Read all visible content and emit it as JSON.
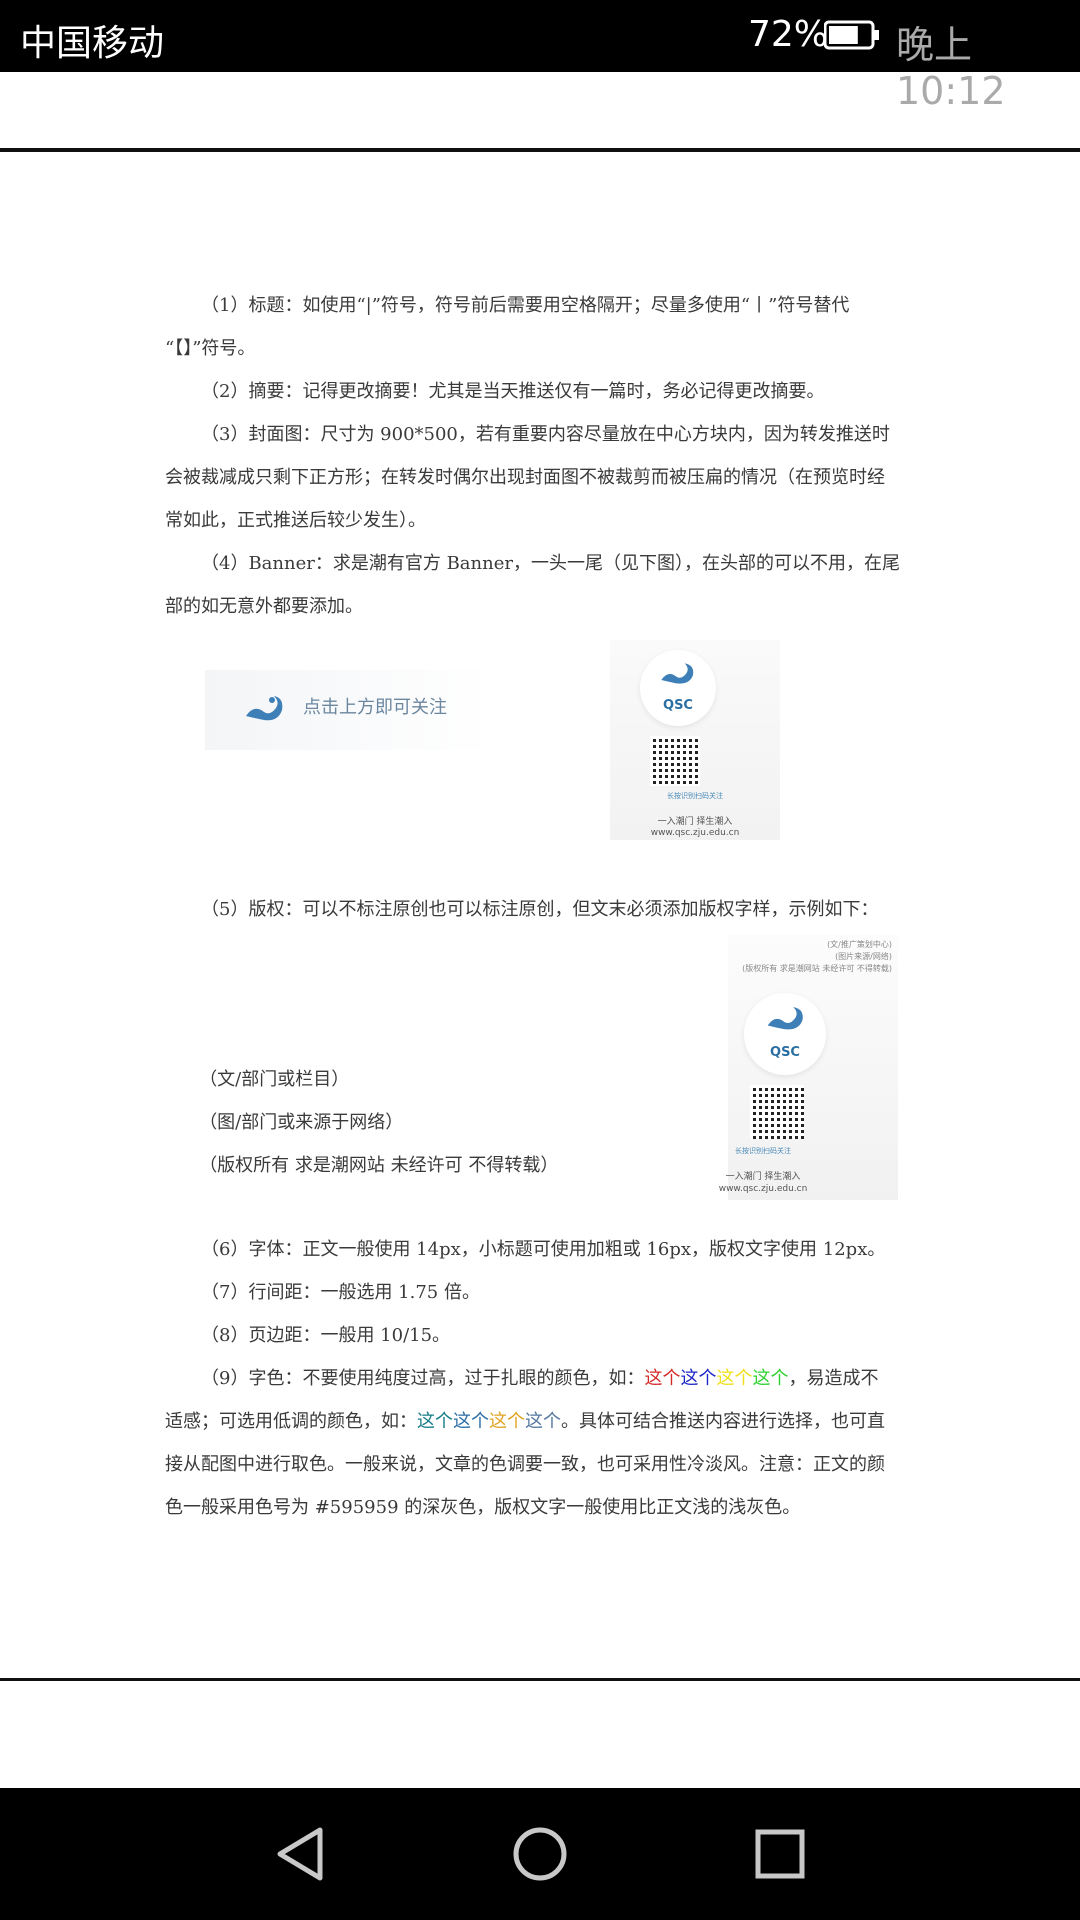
{
  "status_bar": {
    "carrier": "中国移动",
    "battery_percent": "72%",
    "battery_level": 0.72,
    "time": "晚上10:12"
  },
  "doc": {
    "p1_a": "（1）标题：如使用“|”符号，符号前后需要用空格隔开；尽量多使用“丨”符号替代",
    "p1_b": "“【】”符号。",
    "p2": "（2）摘要：记得更改摘要！尤其是当天推送仅有一篇时，务必记得更改摘要。",
    "p3_a": "（3）封面图：尺寸为 900*500，若有重要内容尽量放在中心方块内，因为转发推送时",
    "p3_b": "会被裁减成只剩下正方形；在转发时偶尔出现封面图不被裁剪而被压扁的情况（在预览时经",
    "p3_c": "常如此，正式推送后较少发生）。",
    "p4_a": "（4）Banner：求是潮有官方 Banner，一头一尾（见下图），在头部的可以不用，在尾",
    "p4_b": "部的如无意外都要添加。",
    "banner_text": "点击上方即可关注",
    "qsc": "QSC",
    "qr_caption_small": "长按识别扫码关注",
    "qr_slogan": "一入潮门 择生潮入",
    "qr_url": "www.qsc.zju.edu.cn",
    "p5": "（5）版权：可以不标注原创也可以标注原创，但文末必须添加版权字样，示例如下：",
    "credit_1": "(文/推广策划中心)",
    "credit_2": "(图片来源/网络)",
    "credit_3": "(版权所有 求是潮网站 未经许可 不得转载)",
    "sample_1": "（文/部门或栏目）",
    "sample_2": "（图/部门或来源于网络）",
    "sample_3": "（版权所有 求是潮网站 未经许可 不得转载）",
    "p6": "（6）字体：正文一般使用 14px，小标题可使用加粗或 16px，版权文字使用 12px。",
    "p7": "（7）行间距：一般选用 1.75 倍。",
    "p8": "（8）页边距：一般用 10/15。",
    "p9_a_prefix": "（9）字色：不要使用纯度过高，过于扎眼的颜色，如：",
    "p9_a_w1": "这个",
    "p9_a_w2": "这个",
    "p9_a_w3": "这个",
    "p9_a_w4": "这个",
    "p9_a_suffix": "，易造成不",
    "p9_b_prefix": "适感；可选用低调的颜色，如：",
    "p9_b_w1": "这个",
    "p9_b_w2": "这个",
    "p9_b_w3": "这个",
    "p9_b_w4": "这个",
    "p9_b_suffix": "。具体可结合推送内容进行选择，也可直",
    "p9_c": "接从配图中进行取色。一般来说，文章的色调要一致，也可采用性冷淡风。注意：正文的颜",
    "p9_d": "色一般采用色号为 #595959 的深灰色，版权文字一般使用比正文浅的浅灰色。"
  },
  "nav": {
    "back_icon": "back-triangle-icon",
    "home_icon": "home-circle-icon",
    "recents_icon": "recents-square-icon"
  },
  "colors": {
    "harsh": [
      "#d42a2a",
      "#1d27c7",
      "#f0e01a",
      "#2fd12f"
    ],
    "soft": [
      "#167d86",
      "#2b6ea5",
      "#e0a323",
      "#5477a0"
    ]
  }
}
